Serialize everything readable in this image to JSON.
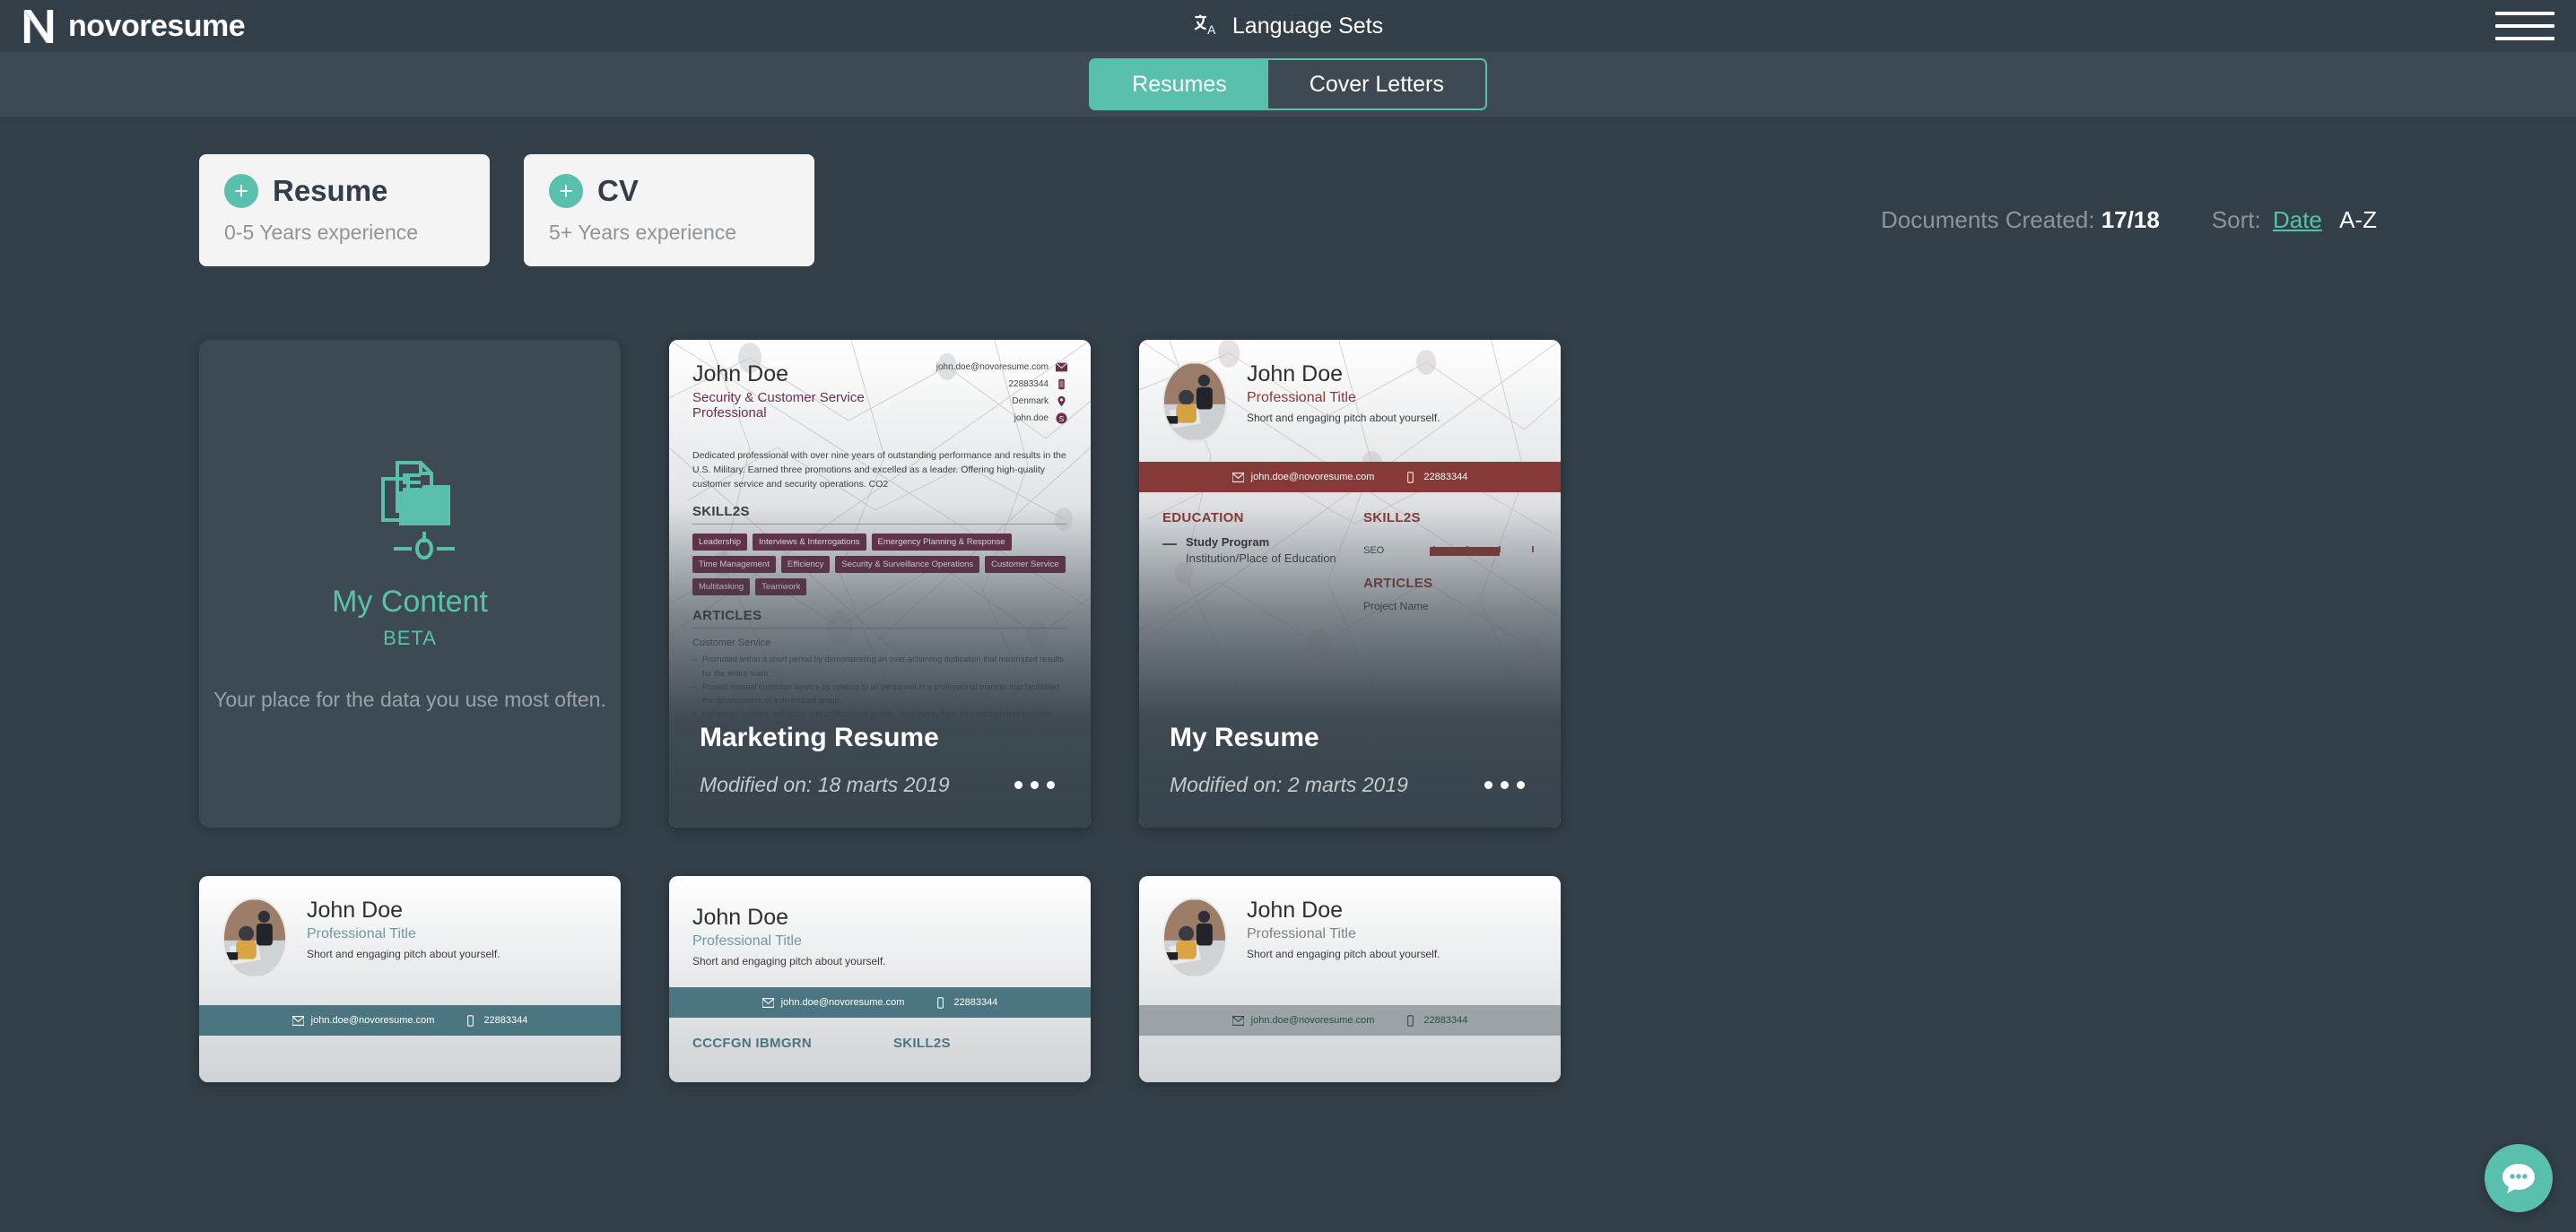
{
  "header": {
    "brand": "novoresume",
    "brand_icon": "novoresume-n-logo",
    "language_sets": "Language Sets",
    "translate_icon": "translate-icon",
    "menu_icon": "hamburger-menu-icon"
  },
  "tabs": [
    {
      "label": "Resumes",
      "active": true
    },
    {
      "label": "Cover Letters",
      "active": false
    }
  ],
  "create": [
    {
      "title": "Resume",
      "subtitle": "0-5 Years experience",
      "icon": "plus-icon"
    },
    {
      "title": "CV",
      "subtitle": "5+ Years experience",
      "icon": "plus-icon"
    }
  ],
  "meta": {
    "documents_created_label": "Documents Created:",
    "documents_created_value": "17/18",
    "sort_label": "Sort:",
    "sort_date": "Date",
    "sort_az": "A-Z"
  },
  "my_content": {
    "icon": "folder-document-icon",
    "title": "My Content",
    "badge": "BETA",
    "description": "Your place for the data you use most often."
  },
  "cards": {
    "marketing": {
      "title": "Marketing Resume",
      "modified": "Modified on: 18 marts 2019",
      "menu_icon": "more-options-icon",
      "preview": {
        "name": "John Doe",
        "role": "Security & Customer Service Professional",
        "contacts": [
          {
            "value": "john.doe@novoresume.com",
            "icon": "mail-icon"
          },
          {
            "value": "22883344",
            "icon": "phone-icon"
          },
          {
            "value": "Denmark",
            "icon": "location-icon"
          },
          {
            "value": "john.doe",
            "icon": "skype-icon"
          }
        ],
        "summary": "Dedicated professional with over nine years of outstanding performance and results in the U.S. Military. Earned three promotions and excelled as a leader. Offering high-quality customer service and security operations. CO2",
        "skills_heading": "SKILL2S",
        "skills": [
          "Leadership",
          "Interviews & Interrogations",
          "Emergency Planning & Response",
          "Time Management",
          "Efficiency",
          "Security & Surveillance Operations",
          "Customer Service",
          "Multitasking",
          "Teamwork"
        ],
        "articles_heading": "ARTICLES",
        "articles_sub": "Customer Service",
        "bullets": [
          "Promoted within a short period by demonstrating an over-achieving dedication that maximized results for the entire team.",
          "Proved internal customer service by relating to all personnel in a professional manner that facilitated the development of a diversified group.",
          "Enhanced soldiers' individual and professional growth, developing them into independent decision-makers."
        ],
        "accent": "#6d2f4a"
      }
    },
    "my_resume": {
      "title": "My Resume",
      "modified": "Modified on: 2 marts 2019",
      "menu_icon": "more-options-icon",
      "preview": {
        "name": "John Doe",
        "role": "Professional Title",
        "pitch": "Short and engaging pitch about yourself.",
        "email": "john.doe@novoresume.com",
        "phone": "22883344",
        "education_heading": "EDUCATION",
        "study_program": "Study Program",
        "institution": "Institution/Place of Education",
        "skills_heading": "SKILL2S",
        "skill_label": "SEO",
        "skill_percent": 65,
        "articles_heading": "ARTICLES",
        "project": "Project Name",
        "accent": "#8a3a37"
      }
    },
    "row2": [
      {
        "name": "John Doe",
        "role": "Professional Title",
        "pitch": "Short and engaging pitch about yourself.",
        "email": "john.doe@novoresume.com",
        "phone": "22883344",
        "accent": "#4b7580",
        "role_color": "#6e99a3",
        "education_heading": "",
        "skills_heading": ""
      },
      {
        "name": "John Doe",
        "role": "Professional Title",
        "pitch": "Short and engaging pitch about yourself.",
        "email": "john.doe@novoresume.com",
        "phone": "22883344",
        "accent": "#4b7580",
        "role_color": "#6e99a3",
        "education_heading": "CCCFGN IBMGRN",
        "skills_heading": "SKILL2S"
      },
      {
        "name": "John Doe",
        "role": "Professional Title",
        "pitch": "Short and engaging pitch about yourself.",
        "email": "john.doe@novoresume.com",
        "phone": "22883344",
        "accent": "#9ba3a6",
        "role_color": "#7a8489",
        "education_heading": "",
        "skills_heading": ""
      }
    ]
  },
  "chat": {
    "icon": "chat-bubble-icon"
  },
  "colors": {
    "page_bg": "#333f48",
    "band_bg": "#3e4a53",
    "accent_teal": "#58c0ac",
    "card_light": "#f4f4f4"
  }
}
